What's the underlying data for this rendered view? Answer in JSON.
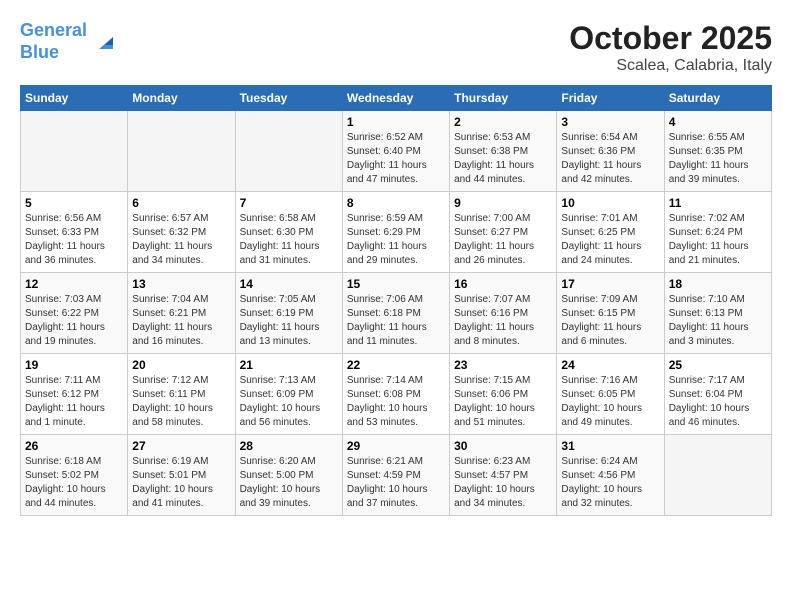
{
  "header": {
    "logo_line1": "General",
    "logo_line2": "Blue",
    "title": "October 2025",
    "subtitle": "Scalea, Calabria, Italy"
  },
  "days_of_week": [
    "Sunday",
    "Monday",
    "Tuesday",
    "Wednesday",
    "Thursday",
    "Friday",
    "Saturday"
  ],
  "weeks": [
    [
      {
        "num": "",
        "info": ""
      },
      {
        "num": "",
        "info": ""
      },
      {
        "num": "",
        "info": ""
      },
      {
        "num": "1",
        "info": "Sunrise: 6:52 AM\nSunset: 6:40 PM\nDaylight: 11 hours and 47 minutes."
      },
      {
        "num": "2",
        "info": "Sunrise: 6:53 AM\nSunset: 6:38 PM\nDaylight: 11 hours and 44 minutes."
      },
      {
        "num": "3",
        "info": "Sunrise: 6:54 AM\nSunset: 6:36 PM\nDaylight: 11 hours and 42 minutes."
      },
      {
        "num": "4",
        "info": "Sunrise: 6:55 AM\nSunset: 6:35 PM\nDaylight: 11 hours and 39 minutes."
      }
    ],
    [
      {
        "num": "5",
        "info": "Sunrise: 6:56 AM\nSunset: 6:33 PM\nDaylight: 11 hours and 36 minutes."
      },
      {
        "num": "6",
        "info": "Sunrise: 6:57 AM\nSunset: 6:32 PM\nDaylight: 11 hours and 34 minutes."
      },
      {
        "num": "7",
        "info": "Sunrise: 6:58 AM\nSunset: 6:30 PM\nDaylight: 11 hours and 31 minutes."
      },
      {
        "num": "8",
        "info": "Sunrise: 6:59 AM\nSunset: 6:29 PM\nDaylight: 11 hours and 29 minutes."
      },
      {
        "num": "9",
        "info": "Sunrise: 7:00 AM\nSunset: 6:27 PM\nDaylight: 11 hours and 26 minutes."
      },
      {
        "num": "10",
        "info": "Sunrise: 7:01 AM\nSunset: 6:25 PM\nDaylight: 11 hours and 24 minutes."
      },
      {
        "num": "11",
        "info": "Sunrise: 7:02 AM\nSunset: 6:24 PM\nDaylight: 11 hours and 21 minutes."
      }
    ],
    [
      {
        "num": "12",
        "info": "Sunrise: 7:03 AM\nSunset: 6:22 PM\nDaylight: 11 hours and 19 minutes."
      },
      {
        "num": "13",
        "info": "Sunrise: 7:04 AM\nSunset: 6:21 PM\nDaylight: 11 hours and 16 minutes."
      },
      {
        "num": "14",
        "info": "Sunrise: 7:05 AM\nSunset: 6:19 PM\nDaylight: 11 hours and 13 minutes."
      },
      {
        "num": "15",
        "info": "Sunrise: 7:06 AM\nSunset: 6:18 PM\nDaylight: 11 hours and 11 minutes."
      },
      {
        "num": "16",
        "info": "Sunrise: 7:07 AM\nSunset: 6:16 PM\nDaylight: 11 hours and 8 minutes."
      },
      {
        "num": "17",
        "info": "Sunrise: 7:09 AM\nSunset: 6:15 PM\nDaylight: 11 hours and 6 minutes."
      },
      {
        "num": "18",
        "info": "Sunrise: 7:10 AM\nSunset: 6:13 PM\nDaylight: 11 hours and 3 minutes."
      }
    ],
    [
      {
        "num": "19",
        "info": "Sunrise: 7:11 AM\nSunset: 6:12 PM\nDaylight: 11 hours and 1 minute."
      },
      {
        "num": "20",
        "info": "Sunrise: 7:12 AM\nSunset: 6:11 PM\nDaylight: 10 hours and 58 minutes."
      },
      {
        "num": "21",
        "info": "Sunrise: 7:13 AM\nSunset: 6:09 PM\nDaylight: 10 hours and 56 minutes."
      },
      {
        "num": "22",
        "info": "Sunrise: 7:14 AM\nSunset: 6:08 PM\nDaylight: 10 hours and 53 minutes."
      },
      {
        "num": "23",
        "info": "Sunrise: 7:15 AM\nSunset: 6:06 PM\nDaylight: 10 hours and 51 minutes."
      },
      {
        "num": "24",
        "info": "Sunrise: 7:16 AM\nSunset: 6:05 PM\nDaylight: 10 hours and 49 minutes."
      },
      {
        "num": "25",
        "info": "Sunrise: 7:17 AM\nSunset: 6:04 PM\nDaylight: 10 hours and 46 minutes."
      }
    ],
    [
      {
        "num": "26",
        "info": "Sunrise: 6:18 AM\nSunset: 5:02 PM\nDaylight: 10 hours and 44 minutes."
      },
      {
        "num": "27",
        "info": "Sunrise: 6:19 AM\nSunset: 5:01 PM\nDaylight: 10 hours and 41 minutes."
      },
      {
        "num": "28",
        "info": "Sunrise: 6:20 AM\nSunset: 5:00 PM\nDaylight: 10 hours and 39 minutes."
      },
      {
        "num": "29",
        "info": "Sunrise: 6:21 AM\nSunset: 4:59 PM\nDaylight: 10 hours and 37 minutes."
      },
      {
        "num": "30",
        "info": "Sunrise: 6:23 AM\nSunset: 4:57 PM\nDaylight: 10 hours and 34 minutes."
      },
      {
        "num": "31",
        "info": "Sunrise: 6:24 AM\nSunset: 4:56 PM\nDaylight: 10 hours and 32 minutes."
      },
      {
        "num": "",
        "info": ""
      }
    ]
  ]
}
